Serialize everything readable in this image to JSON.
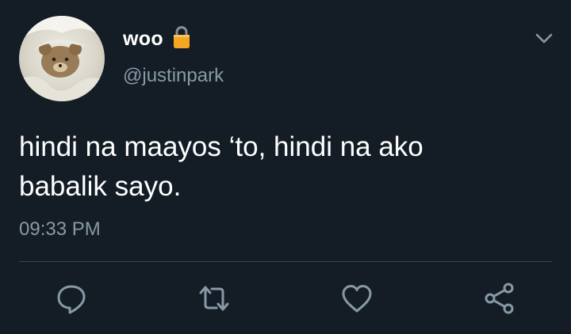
{
  "user": {
    "display_name": "woo",
    "handle": "@justinpark",
    "avatar_icon": "teddy-bear-in-blanket",
    "lock_color": "#f5a623"
  },
  "tweet": {
    "text": "hindi na maayos ‘to, hindi na ako\nbabalik sayo.",
    "timestamp": "09:33 PM"
  },
  "actions": [
    "reply-icon",
    "retweet-icon",
    "like-icon",
    "share-icon"
  ],
  "colors": {
    "background": "#141d26",
    "text": "#ffffff",
    "secondary": "#8899a6",
    "divider": "#38444d"
  }
}
